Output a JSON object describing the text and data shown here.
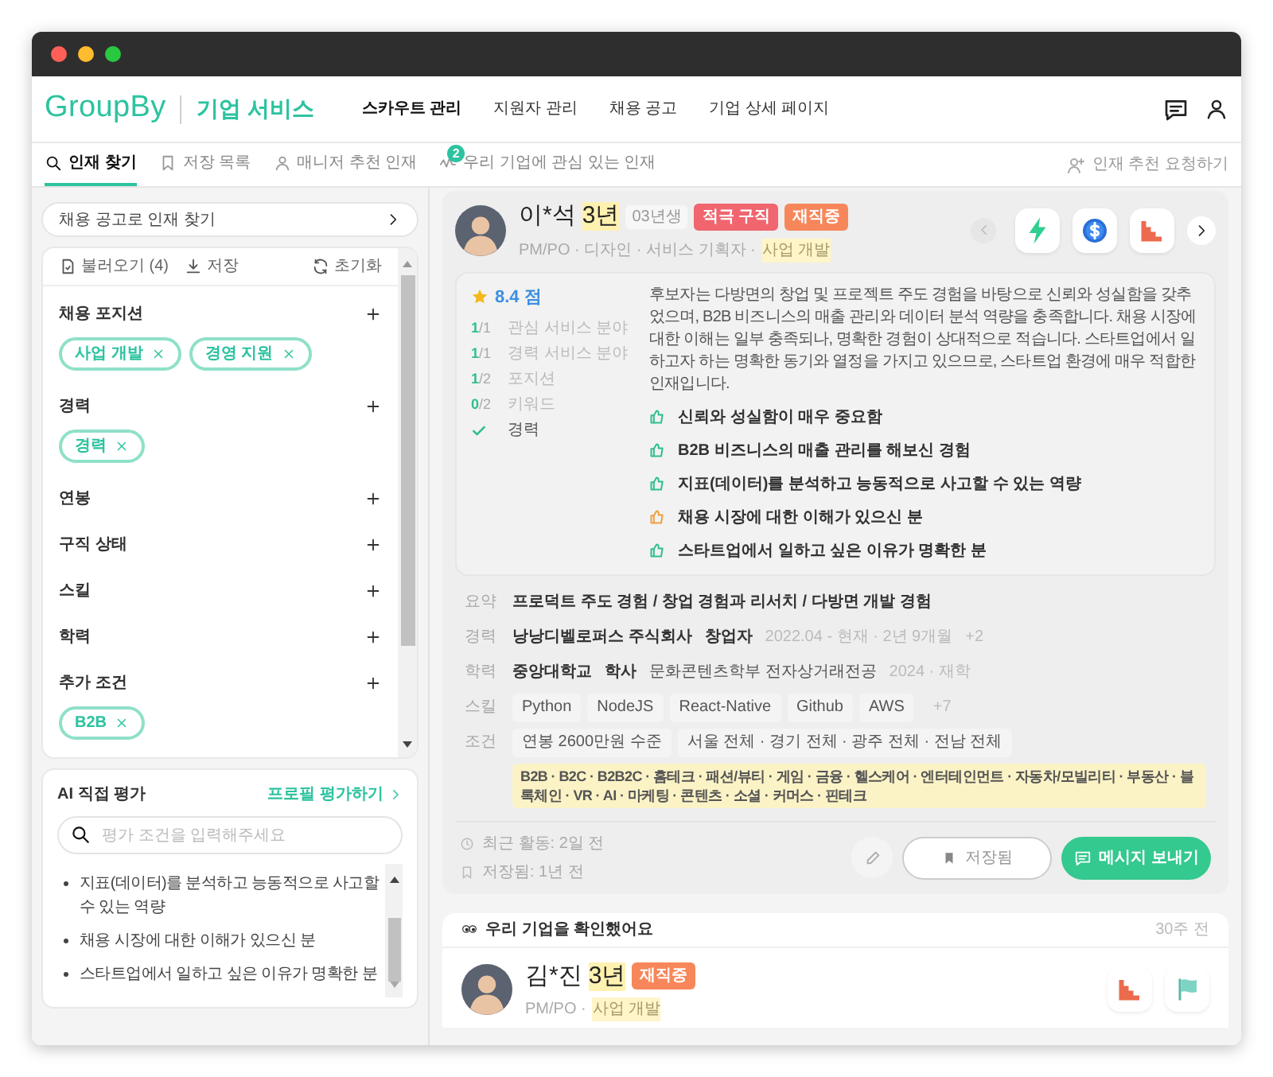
{
  "header": {
    "logo": "GroupBy",
    "service": "기업 서비스",
    "nav": [
      {
        "label": "스카우트 관리",
        "selected": true
      },
      {
        "label": "지원자 관리",
        "selected": false
      },
      {
        "label": "채용 공고",
        "selected": false
      },
      {
        "label": "기업 상세 페이지",
        "selected": false
      }
    ]
  },
  "tabs": [
    {
      "label": "인재 찾기",
      "selected": true
    },
    {
      "label": "저장 목록",
      "selected": false
    },
    {
      "label": "매니저 추천 인재",
      "selected": false
    },
    {
      "label": "우리 기업에 관심 있는 인재",
      "selected": false,
      "badge": "2"
    }
  ],
  "request_link": "인재 추천 요청하기",
  "sidebar": {
    "job_search": "채용 공고로 인재 찾기",
    "load": "불러오기 (4)",
    "save": "저장",
    "reset": "초기화",
    "filters": [
      {
        "title": "채용 포지션",
        "chips": [
          "사업 개발",
          "경영 지원"
        ]
      },
      {
        "title": "경력",
        "chips": [
          "경력"
        ]
      },
      {
        "title": "연봉"
      },
      {
        "title": "구직 상태"
      },
      {
        "title": "스킬"
      },
      {
        "title": "학력"
      },
      {
        "title": "추가 조건",
        "chips": [
          "B2B"
        ]
      }
    ]
  },
  "ai_eval": {
    "title": "AI 직접 평가",
    "link": "프로필 평가하기",
    "placeholder": "평가 조건을 입력해주세요",
    "items": [
      "지표(데이터)를 분석하고 능동적으로 사고할 수 있는 역량",
      "채용 시장에 대한 이해가 있으신 분",
      "스타트업에서 일하고 싶은 이유가 명확한 분"
    ]
  },
  "candidates": [
    {
      "name": "이*석",
      "years": "3년",
      "birth": "03년생",
      "tags": [
        {
          "label": "적극 구직",
          "color": "#f0656e"
        },
        {
          "label": "재직중",
          "color": "#f7875a"
        }
      ],
      "roles": [
        {
          "label": "PM/PO · 디자인 · 서비스 기획자 ·",
          "highlighted": false
        },
        {
          "label": "사업 개발",
          "highlighted": true
        }
      ],
      "score": "8.4 점",
      "criteria": [
        {
          "kind": "ratio",
          "got": "1",
          "of": "/1",
          "label": "관심 서비스 분야"
        },
        {
          "kind": "ratio",
          "got": "1",
          "of": "/1",
          "label": "경력 서비스 분야"
        },
        {
          "kind": "ratio",
          "got": "1",
          "of": "/2",
          "label": "포지션"
        },
        {
          "kind": "ratio",
          "got": "0",
          "of": "/2",
          "label": "키워드"
        },
        {
          "kind": "check",
          "label": "경력"
        }
      ],
      "summary": "후보자는 다방면의 창업 및 프로젝트 주도 경험을 바탕으로 신뢰와 성실함을 갖추었으며, B2B 비즈니스의 매출 관리와 데이터 분석 역량을 충족합니다. 채용 시장에 대한 이해는 일부 충족되나, 명확한 경험이 상대적으로 적습니다. 스타트업에서 일하고자 하는 명확한 동기와 열정을 가지고 있으므로, 스타트업 환경에 매우 적합한 인재입니다.",
      "points": [
        {
          "text": "신뢰와 성실함이 매우 중요함",
          "kind": "positive"
        },
        {
          "text": "B2B 비즈니스의 매출 관리를 해보신 경험",
          "kind": "positive"
        },
        {
          "text": "지표(데이터)를 분석하고 능동적으로 사고할 수 있는 역량",
          "kind": "positive"
        },
        {
          "text": "채용 시장에 대한 이해가 있으신 분",
          "kind": "partial"
        },
        {
          "text": "스타트업에서 일하고 싶은 이유가 명확한 분",
          "kind": "positive"
        }
      ],
      "details": [
        {
          "kind": "text",
          "label": "요약",
          "parts": [
            {
              "text": "프로덕트 주도 경험 / 창업 경험과 리서치 / 다방면 개발 경험",
              "kind": "strong"
            }
          ]
        },
        {
          "kind": "text",
          "label": "경력",
          "parts": [
            {
              "text": "낭낭디벨로퍼스 주식회사",
              "kind": "strong"
            },
            {
              "text": "창업자",
              "kind": "strong"
            },
            {
              "text": "2022.04 - 현재 · 2년 9개월",
              "kind": "muted"
            },
            {
              "text": "+2",
              "kind": "muted"
            }
          ]
        },
        {
          "kind": "text",
          "label": "학력",
          "parts": [
            {
              "text": "중앙대학교",
              "kind": "strong"
            },
            {
              "text": "학사",
              "kind": "strong"
            },
            {
              "text": "문화콘텐츠학부 전자상거래전공",
              "kind": "normal"
            },
            {
              "text": "2024 · 재학",
              "kind": "muted"
            }
          ]
        },
        {
          "kind": "chips",
          "label": "스킬",
          "chips": [
            "Python",
            "NodeJS",
            "React-Native",
            "Github",
            "AWS"
          ],
          "more": "+7"
        },
        {
          "kind": "chips",
          "label": "조건",
          "chips": [
            "연봉 2600만원 수준",
            "서울 전체 · 경기 전체 · 광주 전체 · 전남 전체"
          ],
          "note": "B2B · B2C · B2B2C · 홈테크 · 패션/뷰티 · 게임 · 금융 · 헬스케어 · 엔터테인먼트 · 자동차/모빌리티 · 부동산 · 블록체인 · VR · AI · 마케팅 · 콘텐츠 · 소셜 · 커머스 · 핀테크"
        }
      ],
      "activity": [
        "최근 활동: 2일 전",
        "저장됨: 1년 전"
      ],
      "saved_button": "저장됨",
      "message_button": "메시지 보내기"
    },
    {
      "notice": "우리 기업을 확인했어요",
      "time": "30주 전",
      "name": "김*진",
      "years": "3년",
      "tags": [
        {
          "label": "재직중",
          "color": "#f7875a"
        }
      ],
      "roles": [
        {
          "label": "PM/PO ·",
          "highlighted": false
        },
        {
          "label": "사업 개발",
          "highlighted": true
        }
      ]
    }
  ]
}
